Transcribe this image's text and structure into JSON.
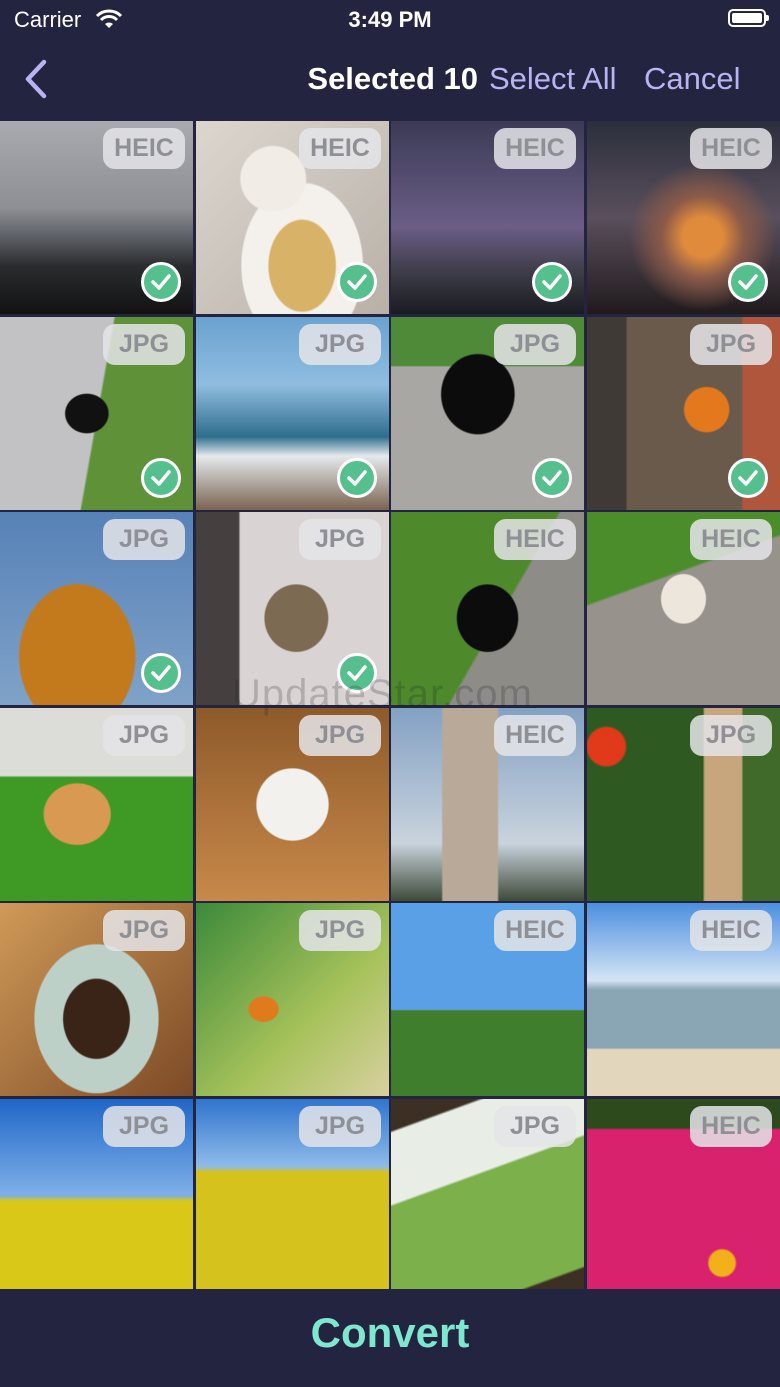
{
  "status_bar": {
    "carrier": "Carrier",
    "time": "3:49 PM"
  },
  "nav": {
    "title": "Selected 10",
    "select_all_label": "Select All",
    "cancel_label": "Cancel"
  },
  "watermark": "UpdateStar.com",
  "colors": {
    "background": "#232540",
    "accent_lavender": "#b9b3f2",
    "accent_mint": "#7de8cf",
    "check_green": "#55c08d"
  },
  "photos": [
    {
      "format": "HEIC",
      "selected": true,
      "subject": "car-dashboard"
    },
    {
      "format": "HEIC",
      "selected": true,
      "subject": "coffee-cake"
    },
    {
      "format": "HEIC",
      "selected": true,
      "subject": "trees-dusk"
    },
    {
      "format": "HEIC",
      "selected": true,
      "subject": "street-sunset"
    },
    {
      "format": "JPG",
      "selected": true,
      "subject": "cat-walking"
    },
    {
      "format": "JPG",
      "selected": true,
      "subject": "painting-sea"
    },
    {
      "format": "JPG",
      "selected": true,
      "subject": "cat-pavement"
    },
    {
      "format": "JPG",
      "selected": true,
      "subject": "pumpkin-shelf"
    },
    {
      "format": "JPG",
      "selected": true,
      "subject": "autumn-tree"
    },
    {
      "format": "JPG",
      "selected": true,
      "subject": "cat-window"
    },
    {
      "format": "HEIC",
      "selected": false,
      "subject": "cat-grass"
    },
    {
      "format": "HEIC",
      "selected": false,
      "subject": "calico-bricks"
    },
    {
      "format": "JPG",
      "selected": false,
      "subject": "ginger-cat"
    },
    {
      "format": "JPG",
      "selected": false,
      "subject": "cat-leaves"
    },
    {
      "format": "HEIC",
      "selected": false,
      "subject": "tower-block"
    },
    {
      "format": "JPG",
      "selected": false,
      "subject": "garden-flowers"
    },
    {
      "format": "JPG",
      "selected": false,
      "subject": "chocolate-cake"
    },
    {
      "format": "JPG",
      "selected": false,
      "subject": "painting-monk"
    },
    {
      "format": "HEIC",
      "selected": false,
      "subject": "path-person"
    },
    {
      "format": "HEIC",
      "selected": false,
      "subject": "lake-shore"
    },
    {
      "format": "JPG",
      "selected": false,
      "subject": "rapeseed-field-1"
    },
    {
      "format": "JPG",
      "selected": false,
      "subject": "rapeseed-field-2"
    },
    {
      "format": "JPG",
      "selected": false,
      "subject": "painting-tree"
    },
    {
      "format": "HEIC",
      "selected": false,
      "subject": "pink-flowers"
    }
  ],
  "bottom": {
    "convert_label": "Convert"
  }
}
